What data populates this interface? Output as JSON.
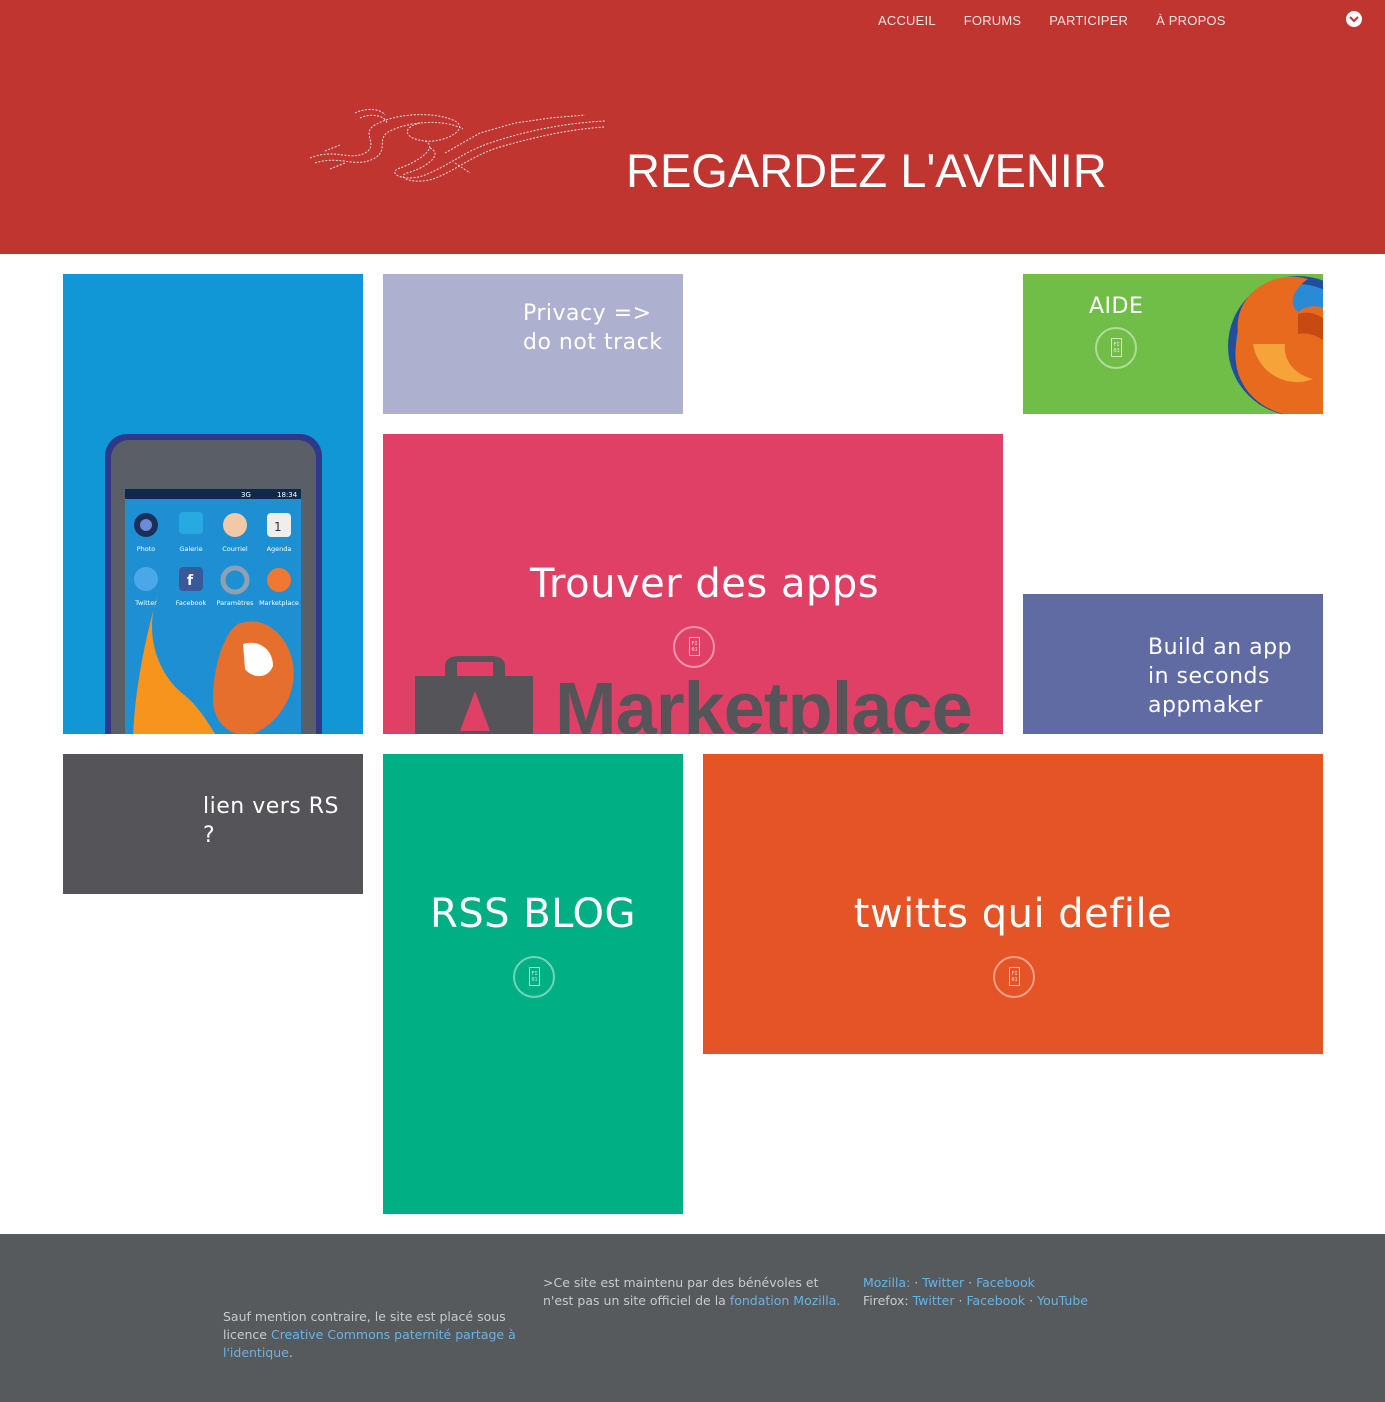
{
  "header": {
    "nav": [
      {
        "label": "ACCUEIL"
      },
      {
        "label": "FORUMS"
      },
      {
        "label": "PARTICIPER"
      },
      {
        "label": "À PROPOS"
      }
    ],
    "hero_title": "REGARDEZ L'AVENIR",
    "colors": {
      "background": "#c13531"
    }
  },
  "tiles": {
    "privacy": {
      "line1": "Privacy =>",
      "line2": "do not track",
      "color": "#adb0cf"
    },
    "aide": {
      "title": "AIDE",
      "color": "#70bd48"
    },
    "apps": {
      "title": "Trouver des apps",
      "logo_text": "Marketplace",
      "color": "#e04065"
    },
    "build": {
      "line1": "Build an app",
      "line2": "in seconds",
      "line3": "appmaker",
      "color": "#5f6ba2"
    },
    "rs": {
      "line1": "lien vers RS",
      "line2": "?",
      "color": "#555559"
    },
    "rss": {
      "title": "RSS BLOG",
      "color": "#00af84"
    },
    "twitts": {
      "title": "twitts qui defile",
      "color": "#e55427"
    },
    "phone": {
      "color": "#1197d6",
      "status_network": "3G",
      "status_time": "18:34",
      "apps_row1": [
        "Photo",
        "Galerie",
        "Courriel",
        "Agenda"
      ],
      "apps_row2": [
        "Twitter",
        "Facebook",
        "Paramètres",
        "Marketplace"
      ]
    }
  },
  "footer": {
    "license_prefix": "Sauf mention contraire, le site est placé sous licence ",
    "license_link": "Creative Commons paternité partage à l'identique",
    "license_suffix": ".",
    "volunteer_prefix": ">Ce site est maintenu par des bénévoles et n'est pas un site officiel de la ",
    "volunteer_link": "fondation Mozilla.",
    "mozilla_label": "Mozilla:",
    "mozilla_twitter": "Twitter",
    "mozilla_facebook": "Facebook",
    "firefox_label": "Firefox:",
    "firefox_twitter": "Twitter",
    "firefox_facebook": "Facebook",
    "firefox_youtube": "YouTube",
    "separator": "·"
  }
}
